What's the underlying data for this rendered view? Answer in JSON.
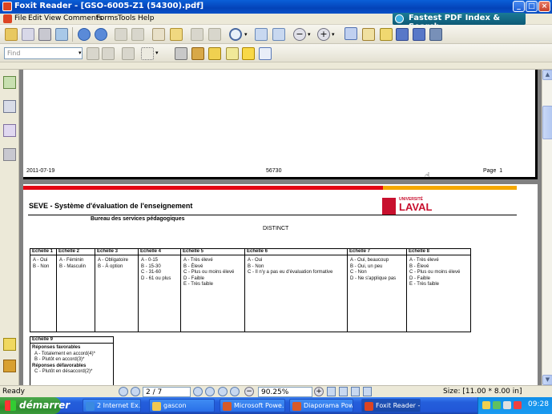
{
  "window": {
    "title": "Foxit Reader - [GSO-6005-Z1 (54300).pdf]",
    "controls": {
      "minimize": "_",
      "restore": "□",
      "close": "×"
    },
    "promo": "Fastest PDF Index & Search"
  },
  "menu": [
    "File",
    "Edit",
    "View",
    "Comments",
    "Forms",
    "Tools",
    "Help"
  ],
  "find": {
    "placeholder": "Find"
  },
  "page1_footer": {
    "date": "2011-07-19",
    "code": "56730",
    "page": "Page  1"
  },
  "page2": {
    "title": "SEVE - Système d'évaluation de l'enseignement",
    "subtitle": "Bureau des services pédagogiques",
    "logo_top": "UNIVERSITÉ",
    "logo_main": "LAVAL",
    "distinct": "DISTINCT",
    "scales": [
      {
        "header": "Echelle 1",
        "lines": [
          "A - Oui",
          "B - Non"
        ]
      },
      {
        "header": "Echelle 2",
        "lines": [
          "A - Féminin",
          "B - Masculin"
        ]
      },
      {
        "header": "Echelle 3",
        "lines": [
          "A - Obligatoire",
          "B - À option"
        ]
      },
      {
        "header": "Echelle 4",
        "lines": [
          "A - 0-15",
          "B - 15-30",
          "C - 31-60",
          "D - 61 ou plus"
        ]
      },
      {
        "header": "Echelle 5",
        "lines": [
          "A - Très élevé",
          "B - Élevé",
          "C - Plus ou moins élevé",
          "D - Faible",
          "E - Très faible"
        ]
      },
      {
        "header": "Echelle 6",
        "lines": [
          "A - Oui",
          "B - Non",
          "C - Il n'y a pas eu d'évaluation formative"
        ]
      },
      {
        "header": "Echelle 7",
        "lines": [
          "A - Oui, beaucoup",
          "B - Oui, un peu",
          "C - Non",
          "D - Ne s'applique pas"
        ]
      },
      {
        "header": "Echelle 8",
        "lines": [
          "A - Très élevé",
          "B - Élevé",
          "C - Plus ou moins élevé",
          "D - Faible",
          "E - Très faible"
        ]
      }
    ],
    "scale9": {
      "header": "Echelle 9",
      "fav_label": "Réponses favorables",
      "fav": [
        "A - Totalement en accord(4)*",
        "B - Plutôt en accord(3)*"
      ],
      "unfav_label": "Réponses défavorables",
      "unfav": [
        "C - Plutôt en désaccord(2)*"
      ]
    }
  },
  "status": {
    "ready": "Ready",
    "page_field": "2 / 7",
    "zoom": "90.25%",
    "size": "Size: [11.00 * 8.00 in]"
  },
  "taskbar": {
    "start": "démarrer",
    "tasks": [
      "2 Internet Ex...",
      "gascon",
      "Microsoft Powe...",
      "Diaporama Pow...",
      "Foxit Reader - ..."
    ],
    "clock": "09:28"
  },
  "colors": {
    "title_blue": "#0443b8",
    "laval_red": "#e30613",
    "laval_gold": "#f5a800",
    "start_green": "#2c8a2c"
  }
}
